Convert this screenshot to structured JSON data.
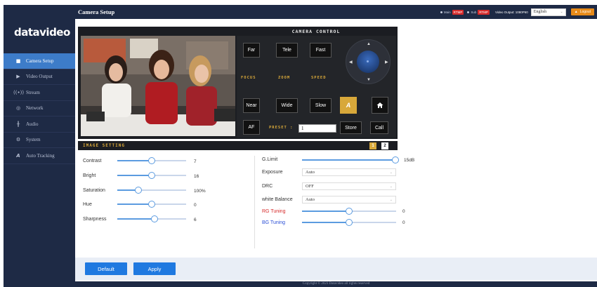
{
  "brand": {
    "logo": "datavideo"
  },
  "header": {
    "title": "Camera Setup",
    "main_label": "Main",
    "main_badge": "RTMP",
    "sub_label": "Sub",
    "sub_badge": "RTMP",
    "video_output": "Video Output: 1080P60",
    "language": "English",
    "logout": "Logout"
  },
  "sidebar": {
    "items": [
      {
        "label": "Camera Setup",
        "icon": "camera-icon",
        "active": true
      },
      {
        "label": "Video Output",
        "icon": "play-icon",
        "active": false
      },
      {
        "label": "Stream",
        "icon": "broadcast-icon",
        "active": false
      },
      {
        "label": "Network",
        "icon": "globe-icon",
        "active": false
      },
      {
        "label": "Audio",
        "icon": "equalizer-icon",
        "active": false
      },
      {
        "label": "System",
        "icon": "gear-icon",
        "active": false
      },
      {
        "label": "Auto Tracking",
        "icon": "ai-icon",
        "active": false
      }
    ]
  },
  "camera_control": {
    "title": "CAMERA CONTROL",
    "focus": {
      "far": "Far",
      "near": "Near",
      "af": "AF",
      "label": "FOCUS"
    },
    "zoom": {
      "tele": "Tele",
      "wide": "Wide",
      "label": "ZOOM"
    },
    "speed": {
      "fast": "Fast",
      "slow": "Slow",
      "label": "SPEED"
    },
    "ai_button": "A",
    "preset": {
      "label": "PRESET :",
      "value": "1",
      "store": "Store",
      "call": "Call"
    }
  },
  "image_setting": {
    "title": "IMAGE SETTING",
    "pages": [
      "1",
      "2"
    ],
    "active_page": "1",
    "left": [
      {
        "label": "Contrast",
        "value": "7",
        "fraction": 0.5
      },
      {
        "label": "Bright",
        "value": "16",
        "fraction": 0.5
      },
      {
        "label": "Saturation",
        "value": "100%",
        "fraction": 0.28
      },
      {
        "label": "Hue",
        "value": "0",
        "fraction": 0.5
      },
      {
        "label": "Sharpness",
        "value": "6",
        "fraction": 0.55
      }
    ],
    "glimit": {
      "label": "G.Limit",
      "value": "15dB",
      "fraction": 1.0
    },
    "exposure": {
      "label": "Exposure",
      "value": "Auto"
    },
    "drc": {
      "label": "DRC",
      "value": "OFF"
    },
    "white_balance": {
      "label": "white Balance",
      "value": "Auto"
    },
    "rg_tuning": {
      "label": "RG Tuning",
      "value": "0",
      "fraction": 0.5,
      "color": "#d62b2b"
    },
    "bg_tuning": {
      "label": "BG Tuning",
      "value": "0",
      "fraction": 0.5,
      "color": "#2b4fd6"
    }
  },
  "actions": {
    "default": "Default",
    "apply": "Apply"
  },
  "footer": {
    "copyright": "Copyright © 2023 Datavideo all rights reserved"
  }
}
